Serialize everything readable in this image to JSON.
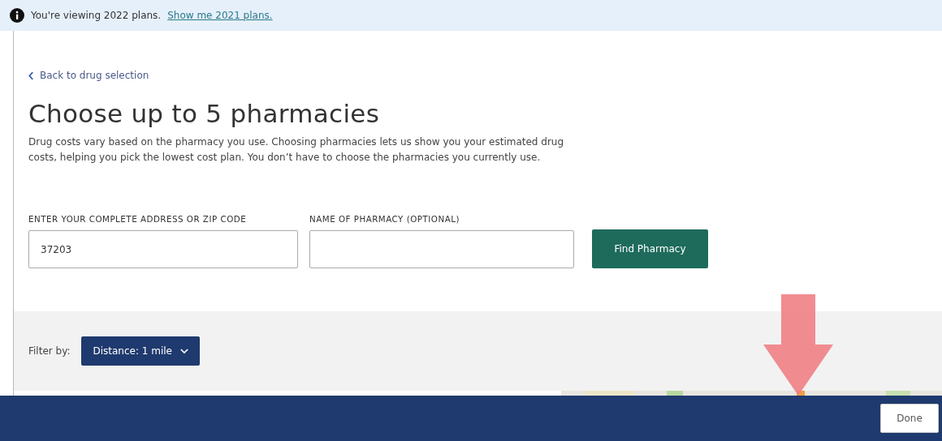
{
  "banner": {
    "text": "You're viewing 2022 plans.",
    "link": "Show me 2021 plans."
  },
  "back_link": "Back to drug selection",
  "heading": "Choose up to 5 pharmacies",
  "description": "Drug costs vary based on the pharmacy you use. Choosing pharmacies lets us show you your estimated drug costs, helping you pick the lowest cost plan. You don’t have to choose the pharmacies you currently use.",
  "fields": [
    {
      "label": "ENTER YOUR COMPLETE ADDRESS OR ZIP CODE",
      "value": "37203"
    },
    {
      "label": "NAME OF PHARMACY (OPTIONAL)"
    }
  ],
  "find_button": "Find Pharmacy",
  "filter": {
    "label": "Filter by:",
    "dropdown": "Distance: 1 mile"
  },
  "footer": {
    "button": "Done"
  }
}
